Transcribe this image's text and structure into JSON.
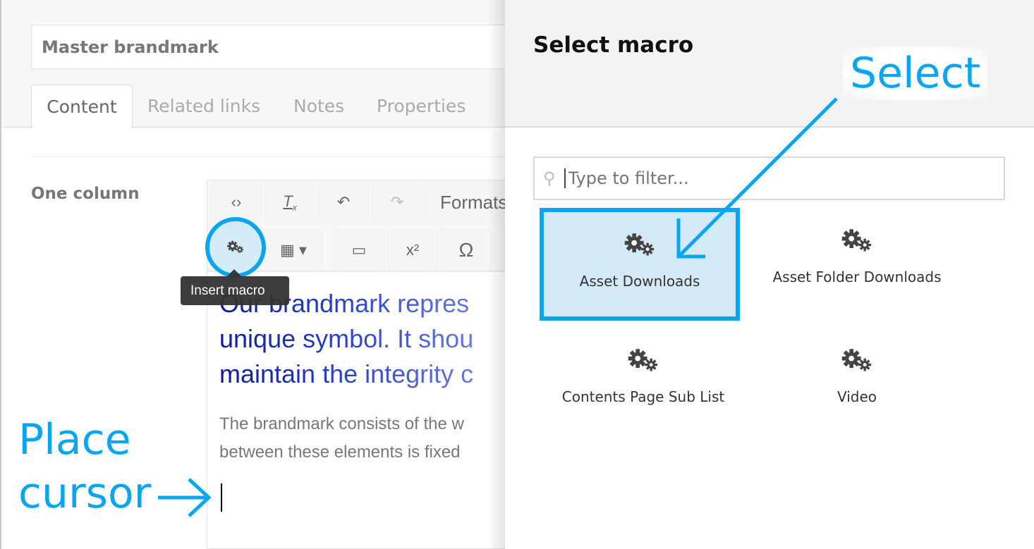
{
  "document": {
    "title": "Master brandmark",
    "tabs": [
      {
        "label": "Content"
      },
      {
        "label": "Related links"
      },
      {
        "label": "Notes"
      },
      {
        "label": "Properties"
      }
    ],
    "field_label": "One column"
  },
  "editor": {
    "toolbar": {
      "formats_label": "Formats",
      "tooltip": "Insert macro",
      "superscript": "x²",
      "omega": "Ω"
    },
    "heading_lines": [
      "Our brandmark repres",
      "unique symbol. It shou",
      "maintain the integrity c"
    ],
    "body_lines": [
      "The brandmark consists of the w",
      "between these elements is fixed"
    ]
  },
  "panel": {
    "title": "Select macro",
    "filter_placeholder": "Type to filter...",
    "macros": [
      {
        "label": "Asset Downloads",
        "selected": true
      },
      {
        "label": "Asset Folder Downloads"
      },
      {
        "label": "Contents Page Sub List"
      },
      {
        "label": "Video"
      }
    ]
  },
  "annotations": {
    "select": "Select",
    "place_line1": "Place",
    "place_line2": "cursor"
  },
  "colors": {
    "accent": "#0aa5ef",
    "selected_bg": "#d4e9f6"
  }
}
